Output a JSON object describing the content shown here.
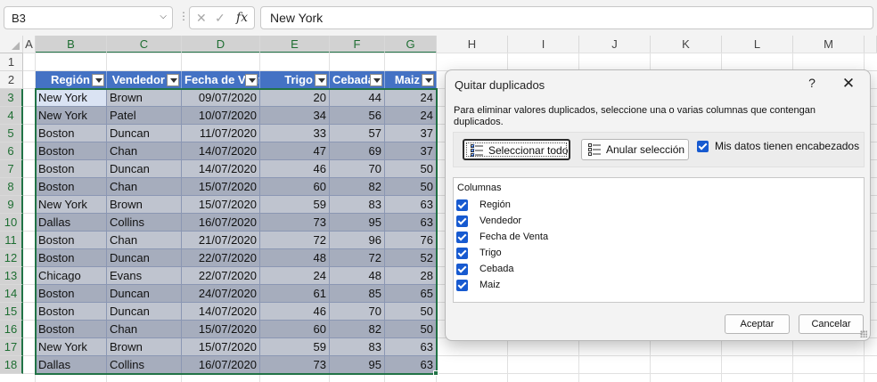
{
  "formula_bar": {
    "name_box": "B3",
    "formula": "New York",
    "fx_label": "fx"
  },
  "columns": [
    "A",
    "B",
    "C",
    "D",
    "E",
    "F",
    "G",
    "H",
    "I",
    "J",
    "K",
    "L",
    "M"
  ],
  "rows": [
    "1",
    "2",
    "3",
    "4",
    "5",
    "6",
    "7",
    "8",
    "9",
    "10",
    "11",
    "12",
    "13",
    "14",
    "15",
    "16",
    "17",
    "18"
  ],
  "table": {
    "headers": [
      "Región",
      "Vendedor",
      "Fecha de Venta",
      "Trigo",
      "Cebada",
      "Maiz"
    ],
    "rows": [
      [
        "New York",
        "Brown",
        "09/07/2020",
        "20",
        "44",
        "24"
      ],
      [
        "New York",
        "Patel",
        "10/07/2020",
        "34",
        "56",
        "24"
      ],
      [
        "Boston",
        "Duncan",
        "11/07/2020",
        "33",
        "57",
        "37"
      ],
      [
        "Boston",
        "Chan",
        "14/07/2020",
        "47",
        "69",
        "37"
      ],
      [
        "Boston",
        "Duncan",
        "14/07/2020",
        "46",
        "70",
        "50"
      ],
      [
        "Boston",
        "Chan",
        "15/07/2020",
        "60",
        "82",
        "50"
      ],
      [
        "New York",
        "Brown",
        "15/07/2020",
        "59",
        "83",
        "63"
      ],
      [
        "Dallas",
        "Collins",
        "16/07/2020",
        "73",
        "95",
        "63"
      ],
      [
        "Boston",
        "Chan",
        "21/07/2020",
        "72",
        "96",
        "76"
      ],
      [
        "Boston",
        "Duncan",
        "22/07/2020",
        "48",
        "72",
        "52"
      ],
      [
        "Chicago",
        "Evans",
        "22/07/2020",
        "24",
        "48",
        "28"
      ],
      [
        "Boston",
        "Duncan",
        "24/07/2020",
        "61",
        "85",
        "65"
      ],
      [
        "Boston",
        "Duncan",
        "14/07/2020",
        "46",
        "70",
        "50"
      ],
      [
        "Boston",
        "Chan",
        "15/07/2020",
        "60",
        "82",
        "50"
      ],
      [
        "New York",
        "Brown",
        "15/07/2020",
        "59",
        "83",
        "63"
      ],
      [
        "Dallas",
        "Collins",
        "16/07/2020",
        "73",
        "95",
        "63"
      ]
    ]
  },
  "dialog": {
    "title": "Quitar duplicados",
    "help": "?",
    "close": "✕",
    "description": "Para eliminar valores duplicados, seleccione una o varias columnas que contengan duplicados.",
    "select_all": "Seleccionar todo",
    "unselect_all": "Anular selección",
    "has_headers": "Mis datos tienen encabezados",
    "columns_caption": "Columnas",
    "columns": [
      "Región",
      "Vendedor",
      "Fecha de Venta",
      "Trigo",
      "Cebada",
      "Maiz"
    ],
    "ok": "Aceptar",
    "cancel": "Cancelar"
  },
  "colors": {
    "accent": "#217346",
    "table_header": "#4472c4",
    "checkbox": "#175ad0"
  }
}
